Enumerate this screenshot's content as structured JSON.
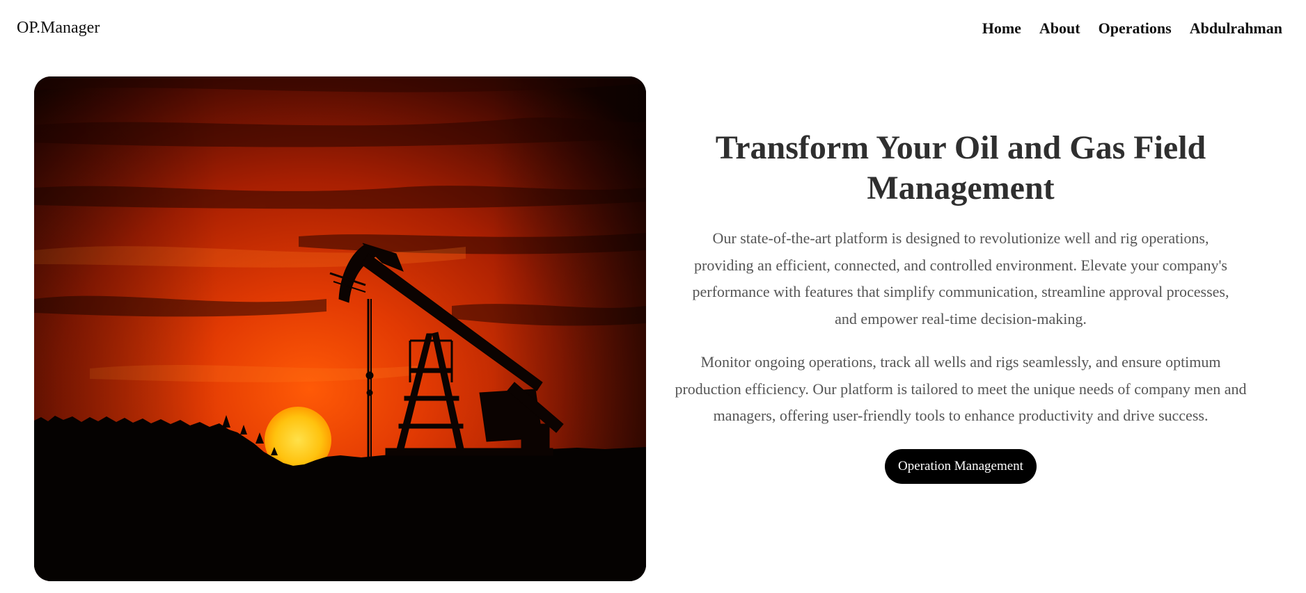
{
  "nav": {
    "brand": "OP.Manager",
    "links": [
      {
        "label": "Home"
      },
      {
        "label": "About"
      },
      {
        "label": "Operations"
      },
      {
        "label": "Abdulrahman"
      }
    ]
  },
  "hero": {
    "image_subject": "oil pumpjack silhouette at sunset",
    "title": "Transform Your Oil and Gas Field Management",
    "paragraph1": "Our state-of-the-art platform is designed to revolutionize well and rig operations, providing an efficient, connected, and controlled environment. Elevate your company's performance with features that simplify communication, streamline approval processes, and empower real-time decision-making.",
    "paragraph2": "Monitor ongoing operations, track all wells and rigs seamlessly, and ensure optimum production efficiency. Our platform is tailored to meet the unique needs of company men and managers, offering user-friendly tools to enhance productivity and drive success.",
    "cta_label": "Operation Management"
  },
  "colors": {
    "button_bg": "#000000",
    "button_text": "#ffffff",
    "heading": "#2f2f2f",
    "body_text": "#555555",
    "sky_orange": "#d83a06",
    "sun_yellow": "#ffc20e"
  }
}
